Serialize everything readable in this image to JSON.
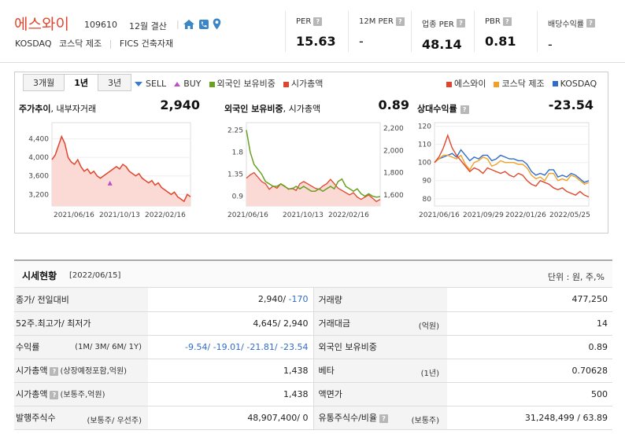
{
  "company": {
    "name": "에스와이",
    "code": "109610",
    "fiscal": "12월 결산",
    "market": "KOSDAQ",
    "sector_market": "코스닥 제조",
    "fics": "FICS 건축자재"
  },
  "metrics": [
    {
      "label": "PER",
      "value": "15.63"
    },
    {
      "label": "12M PER",
      "value": "-"
    },
    {
      "label": "업종 PER",
      "value": "48.14"
    },
    {
      "label": "PBR",
      "value": "0.81"
    },
    {
      "label": "배당수익률",
      "value": "-"
    }
  ],
  "chart_area": {
    "tabs": [
      "3개월",
      "1년",
      "3년"
    ],
    "active_tab": "1년",
    "legend_left": {
      "sell": "SELL",
      "buy": "BUY",
      "foreign": "외국인 보유비중",
      "mcap": "시가총액"
    },
    "legend_right": [
      "에스와이",
      "코스닥 제조",
      "KOSDAQ"
    ],
    "colors": {
      "red": "#e0462d",
      "green": "#6aa123",
      "orange": "#f0a028",
      "blue": "#2f6ccb",
      "fill": "#fbd9d4"
    }
  },
  "panels": {
    "price": {
      "title_bold": "주가추이",
      "title_rest": ", 내부자거래",
      "value": "2,940"
    },
    "foreign": {
      "title_bold": "외국인 보유비중",
      "title_rest": ", 시가총액",
      "value": "0.89"
    },
    "relative": {
      "title_bold": "상대수익률",
      "value": "-23.54"
    }
  },
  "chart_data": [
    {
      "type": "area",
      "title": "주가추이",
      "x_ticks": [
        "2021/06/16",
        "2021/10/13",
        "2022/02/16"
      ],
      "y_ticks": [
        3200,
        3600,
        4000,
        4400
      ],
      "ylim": [
        2950,
        4750
      ],
      "series": [
        {
          "values": [
            3950,
            4050,
            4250,
            4450,
            4300,
            4000,
            3900,
            3850,
            3950,
            3800,
            3700,
            3750,
            3650,
            3700,
            3600,
            3550,
            3600,
            3650,
            3700,
            3750,
            3800,
            3750,
            3850,
            3800,
            3700,
            3650,
            3600,
            3650,
            3550,
            3500,
            3450,
            3500,
            3400,
            3450,
            3350,
            3300,
            3250,
            3200,
            3250,
            3150,
            3100,
            3050,
            3200,
            3150
          ]
        }
      ],
      "buy_marker_index": 18
    },
    {
      "type": "line",
      "title": "외국인 보유비중",
      "x_ticks": [
        "2021/06/16",
        "2021/10/13",
        "2022/02/16"
      ],
      "y_ticks_left": [
        0.9,
        1.35,
        1.8,
        2.25
      ],
      "y_ticks_right": [
        1600,
        1800,
        2000,
        2200
      ],
      "series": [
        {
          "name": "외국인 보유비중",
          "values": [
            2.25,
            1.8,
            1.55,
            1.45,
            1.35,
            1.2,
            1.15,
            1.1,
            1.1,
            1.15,
            1.1,
            1.05,
            1.05,
            1.1,
            1.05,
            1.1,
            1.05,
            1.0,
            1.0,
            1.05,
            1.0,
            1.05,
            1.1,
            1.05,
            1.2,
            1.25,
            1.1,
            1.05,
            1.0,
            1.05,
            0.95,
            0.9,
            0.95,
            0.9,
            0.88,
            0.89
          ]
        },
        {
          "name": "시가총액",
          "values": [
            1750,
            1780,
            1800,
            1760,
            1720,
            1700,
            1650,
            1680,
            1660,
            1700,
            1680,
            1650,
            1660,
            1640,
            1700,
            1720,
            1700,
            1680,
            1660,
            1650,
            1680,
            1700,
            1740,
            1700,
            1660,
            1640,
            1620,
            1600,
            1620,
            1580,
            1560,
            1580,
            1600,
            1570,
            1540,
            1560
          ]
        }
      ]
    },
    {
      "type": "line",
      "title": "상대수익률",
      "x_ticks": [
        "2021/06/16",
        "2021/09/29",
        "2022/01/26",
        "2022/05/25"
      ],
      "y_ticks": [
        80,
        90,
        100,
        110,
        120
      ],
      "ylim": [
        76,
        122
      ],
      "series": [
        {
          "name": "에스와이",
          "values": [
            100,
            103,
            108,
            115,
            108,
            104,
            101,
            98,
            95,
            97,
            96,
            94,
            97,
            96,
            95,
            94,
            95,
            93,
            92,
            94,
            93,
            90,
            88,
            87,
            90,
            89,
            88,
            86,
            85,
            86,
            84,
            83,
            82,
            84,
            82,
            81
          ]
        },
        {
          "name": "코스닥 제조",
          "values": [
            100,
            102,
            104,
            104,
            103,
            102,
            104,
            99,
            96,
            100,
            101,
            103,
            102,
            98,
            99,
            101,
            100,
            100,
            100,
            99,
            99,
            97,
            93,
            91,
            92,
            90,
            94,
            94,
            90,
            91,
            90,
            93,
            92,
            90,
            88,
            89
          ]
        },
        {
          "name": "KOSDAQ",
          "values": [
            100,
            102,
            103,
            104,
            105,
            103,
            107,
            104,
            101,
            103,
            102,
            104,
            104,
            101,
            102,
            104,
            103,
            102,
            102,
            101,
            101,
            99,
            95,
            93,
            94,
            93,
            96,
            96,
            92,
            93,
            92,
            94,
            93,
            91,
            89,
            90
          ]
        }
      ]
    }
  ],
  "summary": {
    "title": "시세현황",
    "date": "[2022/06/15]",
    "unit": "단위 : 원, 주,%",
    "rows": [
      {
        "l_label": "종가/ 전일대비",
        "l_sub": "",
        "l_value": "2,940/ ",
        "l_value2": "-170",
        "r_label": "거래량",
        "r_sub": "",
        "r_value": "477,250"
      },
      {
        "l_label": "52주.최고가/ 최저가",
        "l_sub": "",
        "l_value": "4,645/ 2,940",
        "l_value2": "",
        "r_label": "거래대금",
        "r_sub": "(억원)",
        "r_value": "14"
      },
      {
        "l_label": "수익률",
        "l_sub": "(1M/ 3M/ 6M/ 1Y)",
        "l_value": "",
        "l_value2": "-9.54/ -19.01/ -21.81/ -23.54",
        "r_label": "외국인 보유비중",
        "r_sub": "",
        "r_value": "0.89"
      },
      {
        "l_label": "시가총액",
        "l_sub": "(상장예정포함,억원)",
        "l_value": "1,438",
        "l_value2": "",
        "r_label": "베타",
        "r_sub": "(1년)",
        "r_value": "0.70628"
      },
      {
        "l_label": "시가총액",
        "l_sub": "(보통주,억원)",
        "l_value": "1,438",
        "l_value2": "",
        "r_label": "액면가",
        "r_sub": "",
        "r_value": "500"
      },
      {
        "l_label": "발행주식수",
        "l_sub": "(보통주/ 우선주)",
        "l_value": "48,907,400/ 0",
        "l_value2": "",
        "r_label": "유통주식수/비율",
        "r_sub": "(보통주)",
        "r_value": "31,248,499 / 63.89"
      }
    ]
  }
}
